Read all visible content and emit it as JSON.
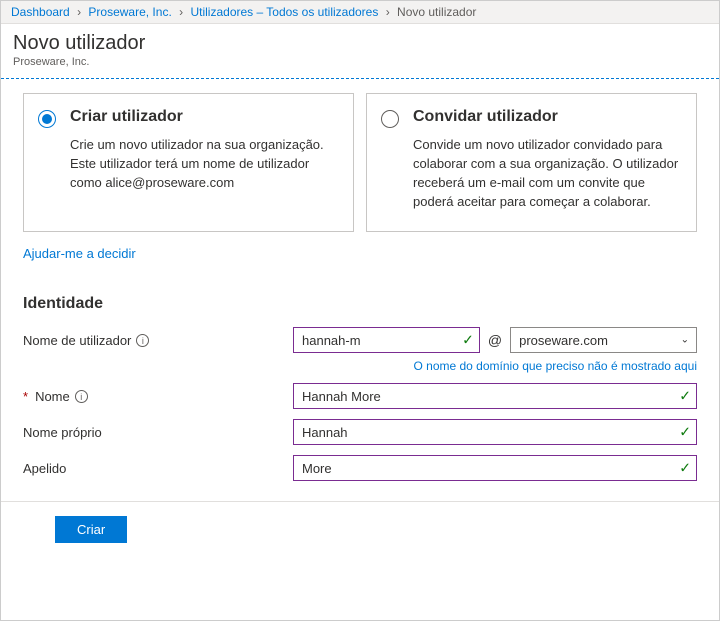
{
  "breadcrumb": {
    "items": [
      {
        "label": "Dashboard"
      },
      {
        "label": "Proseware, Inc."
      },
      {
        "label": "Utilizadores – Todos os utilizadores"
      }
    ],
    "current": "Novo utilizador"
  },
  "header": {
    "title": "Novo utilizador",
    "subtitle": "Proseware, Inc."
  },
  "options": {
    "create": {
      "title": "Criar utilizador",
      "desc": "Crie um novo utilizador na sua organização. Este utilizador terá um nome de utilizador como alice@proseware.com"
    },
    "invite": {
      "title": "Convidar utilizador",
      "desc": "Convide um novo utilizador convidado para colaborar com a sua organização. O utilizador receberá um e-mail com um convite que poderá aceitar para começar a colaborar."
    }
  },
  "help_link": "Ajudar-me a decidir",
  "identity": {
    "section_title": "Identidade",
    "username_label": "Nome de utilizador",
    "username_value": "hannah-m",
    "at": "@",
    "domain_value": "proseware.com",
    "domain_note": "O nome do domínio que preciso não é mostrado aqui",
    "name_label": "Nome",
    "name_value": "Hannah More",
    "firstname_label": "Nome próprio",
    "firstname_value": "Hannah",
    "lastname_label": "Apelido",
    "lastname_value": "More",
    "required_mark": "*"
  },
  "footer": {
    "create_button": "Criar"
  }
}
